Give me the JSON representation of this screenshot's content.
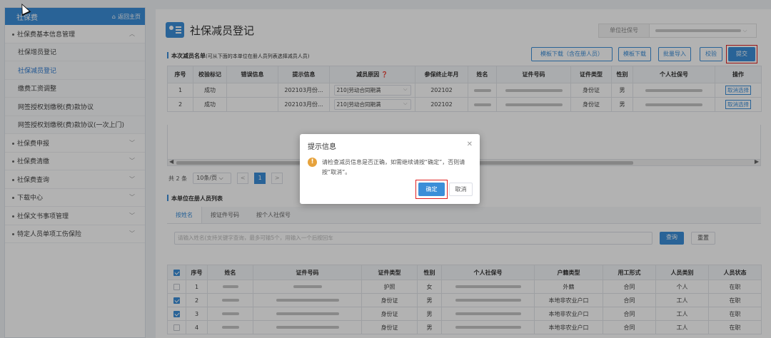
{
  "sidebar": {
    "title": "社保费",
    "home_label": "返回主页",
    "items": [
      {
        "label": "社保费基本信息管理",
        "type": "group",
        "expanded": true
      },
      {
        "label": "社保增员登记",
        "type": "sub"
      },
      {
        "label": "社保减员登记",
        "type": "sub",
        "active": true
      },
      {
        "label": "缴费工资调整",
        "type": "sub"
      },
      {
        "label": "网签授权划缴税(费)款协议",
        "type": "sub"
      },
      {
        "label": "网签授权划缴税(费)款协议(一次上门)",
        "type": "sub"
      },
      {
        "label": "社保费申报",
        "type": "group"
      },
      {
        "label": "社保费清缴",
        "type": "group"
      },
      {
        "label": "社保费查询",
        "type": "group"
      },
      {
        "label": "下载中心",
        "type": "group"
      },
      {
        "label": "社保文书事项管理",
        "type": "group"
      },
      {
        "label": "特定人员单项工伤保险",
        "type": "group"
      }
    ]
  },
  "header": {
    "title": "社保减员登记",
    "unit_label": "单位社保号"
  },
  "section1": {
    "label": "本次减员名单",
    "hint": "(可从下面的本单位在册人员列表选择减员人员)"
  },
  "toolbar": {
    "template_download_roster": "模板下载（含在册人员）",
    "template_download": "模板下载",
    "batch_import": "批量导入",
    "verify": "校验",
    "submit": "提交"
  },
  "table1": {
    "columns": [
      "序号",
      "校验标记",
      "错误信息",
      "提示信息",
      "减员原因",
      "参保终止年月",
      "姓名",
      "证件号码",
      "证件类型",
      "性别",
      "个人社保号",
      "操作"
    ],
    "rows": [
      {
        "no": "1",
        "check": "成功",
        "error": "",
        "hint": "202103月份...",
        "reason": "210|劳动合同期满",
        "end": "202102",
        "idtype": "身份证",
        "sex": "男",
        "action": "取消选择"
      },
      {
        "no": "2",
        "check": "成功",
        "error": "",
        "hint": "202103月份...",
        "reason": "210|劳动合同期满",
        "end": "202102",
        "idtype": "身份证",
        "sex": "男",
        "action": "取消选择"
      }
    ]
  },
  "pager": {
    "total": "共 2 条",
    "page_size": "10条/页",
    "current_page": "1"
  },
  "section2": {
    "label": "本单位在册人员列表"
  },
  "tabs": [
    "按姓名",
    "按证件号码",
    "按个人社保号"
  ],
  "search": {
    "placeholder": "请输入姓名(支持关键字查询，最多可输5个，用输入一个后按回车",
    "query": "查询",
    "reset": "重置"
  },
  "table2": {
    "columns": [
      "序号",
      "姓名",
      "证件号码",
      "证件类型",
      "性别",
      "个人社保号",
      "户籍类型",
      "用工形式",
      "人员类别",
      "人员状态"
    ],
    "rows": [
      {
        "checked": false,
        "no": "1",
        "idtype": "护照",
        "sex": "女",
        "hukou": "外籍",
        "form": "合同",
        "cat": "个人",
        "status": "在职"
      },
      {
        "checked": true,
        "no": "2",
        "idtype": "身份证",
        "sex": "男",
        "hukou": "本地非农业户口",
        "form": "合同",
        "cat": "工人",
        "status": "在职"
      },
      {
        "checked": true,
        "no": "3",
        "idtype": "身份证",
        "sex": "男",
        "hukou": "本地非农业户口",
        "form": "合同",
        "cat": "工人",
        "status": "在职"
      },
      {
        "checked": false,
        "no": "4",
        "idtype": "身份证",
        "sex": "男",
        "hukou": "本地非农业户口",
        "form": "合同",
        "cat": "工人",
        "status": "在职"
      }
    ]
  },
  "dialog": {
    "title": "提示信息",
    "message": "请检查减员信息是否正确，如需继续请按“确定”，否则请按“取消”。",
    "ok": "确定",
    "cancel": "取消"
  },
  "colors": {
    "accent": "#3b8ed8",
    "success": "#52a82f",
    "warning": "#e6a23c",
    "highlight_box": "#e02020"
  }
}
